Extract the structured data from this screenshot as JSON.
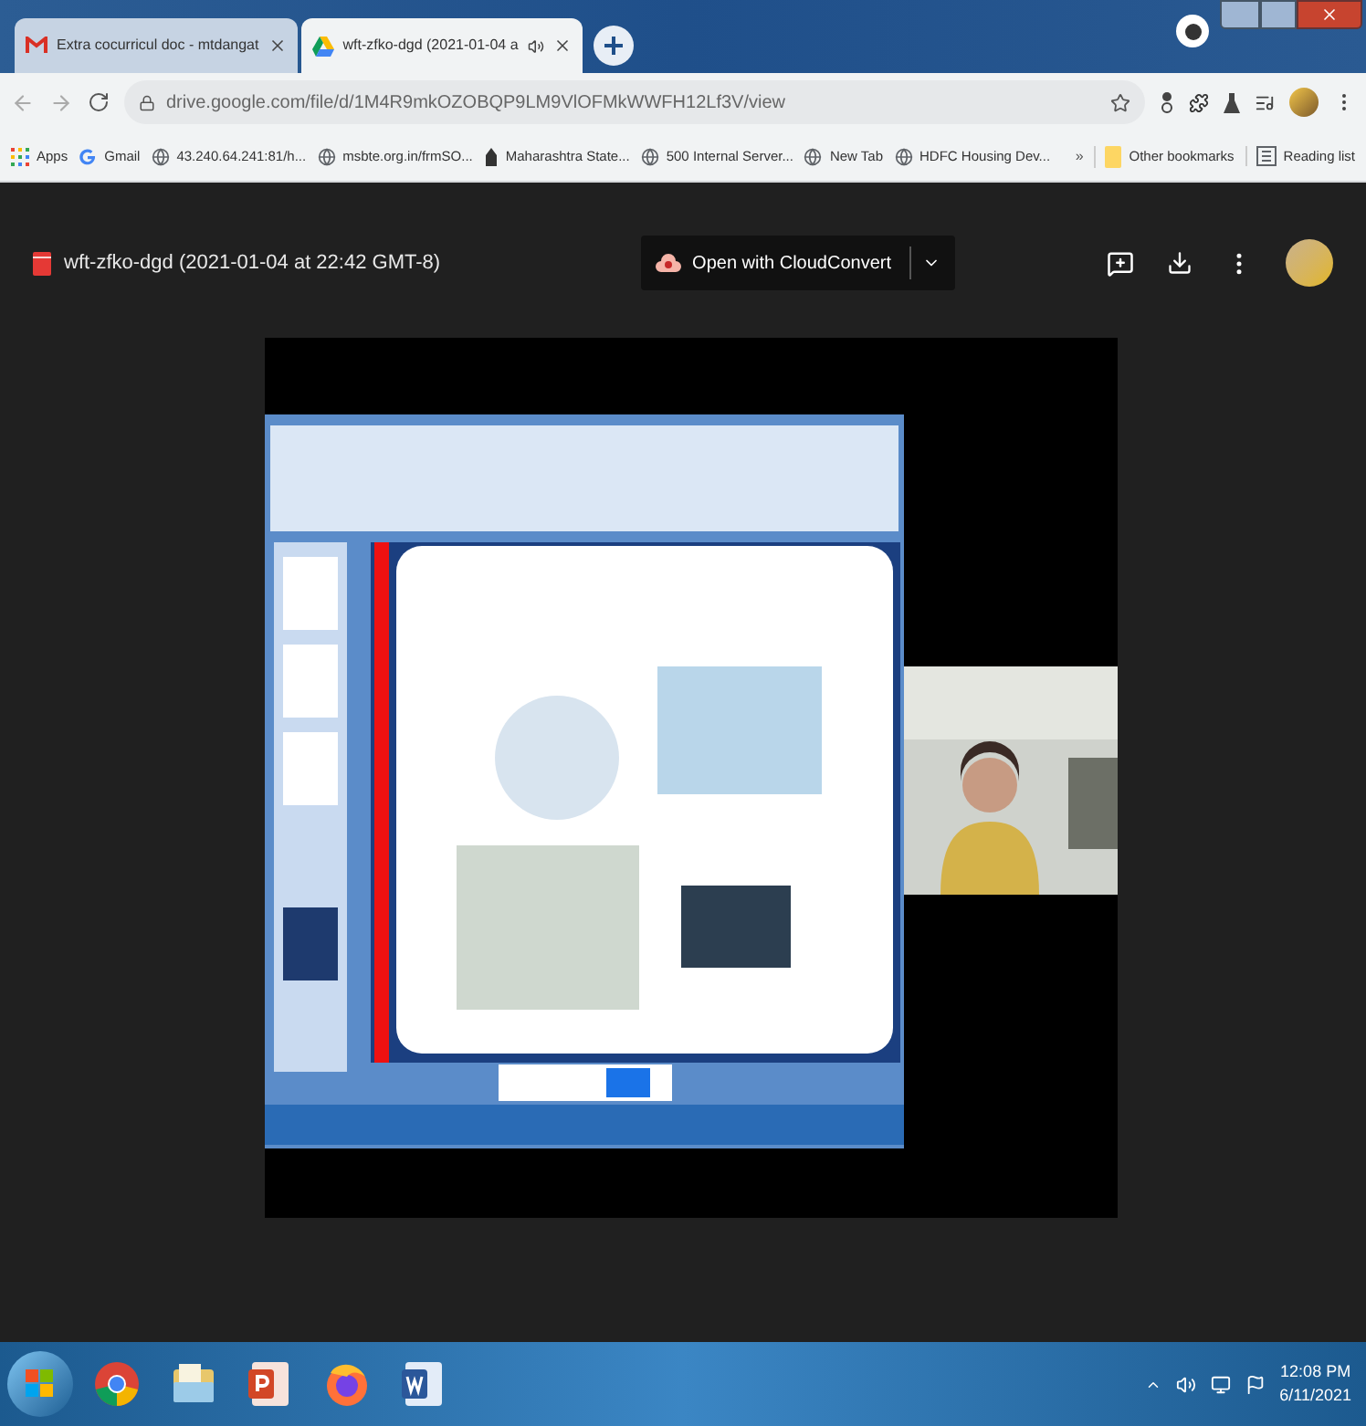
{
  "browser": {
    "tabs": [
      {
        "kind": "mail",
        "title": "Extra cocurricul doc - mtdangat",
        "selected": false,
        "audio": false
      },
      {
        "kind": "drive",
        "title": "wft-zfko-dgd (2021-01-04 a",
        "selected": true,
        "audio": true
      }
    ],
    "url": "drive.google.com/file/d/1M4R9mkOZOBQP9LM9VlOFMkWWFH12Lf3V/view",
    "bookmarks": [
      {
        "kind": "apps",
        "label": "Apps"
      },
      {
        "kind": "google",
        "label": "Gmail"
      },
      {
        "kind": "globe",
        "label": "43.240.64.241:81/h..."
      },
      {
        "kind": "globe",
        "label": "msbte.org.in/frmSO..."
      },
      {
        "kind": "emblem",
        "label": "Maharashtra State..."
      },
      {
        "kind": "globe",
        "label": "500 Internal Server..."
      },
      {
        "kind": "globe",
        "label": "New Tab"
      },
      {
        "kind": "globe",
        "label": "HDFC Housing Dev..."
      }
    ],
    "more_bookmarks": "»",
    "other_bookmarks": [
      {
        "kind": "folder",
        "label": "Other bookmarks"
      },
      {
        "kind": "list",
        "label": "Reading list"
      }
    ]
  },
  "viewer": {
    "file_title": "wft-zfko-dgd (2021-01-04 at 22:42 GMT-8)",
    "open_with": "Open with CloudConvert"
  },
  "taskbar": {
    "apps": [
      {
        "kind": "chrome"
      },
      {
        "kind": "explorer"
      },
      {
        "kind": "powerpoint"
      },
      {
        "kind": "firefox"
      },
      {
        "kind": "word"
      }
    ],
    "time": "12:08 PM",
    "date": "6/11/2021"
  }
}
